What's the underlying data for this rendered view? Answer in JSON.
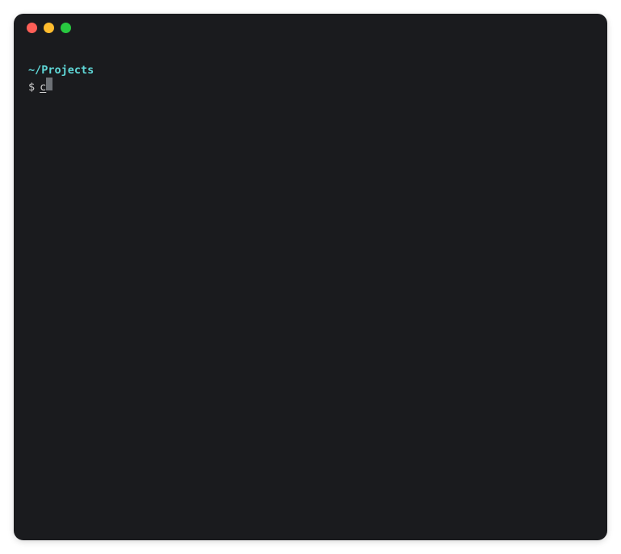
{
  "window": {
    "controls": {
      "close": "close",
      "minimize": "minimize",
      "maximize": "maximize"
    }
  },
  "terminal": {
    "cwd": "~/Projects",
    "prompt_symbol": "$",
    "command_input": "c"
  }
}
